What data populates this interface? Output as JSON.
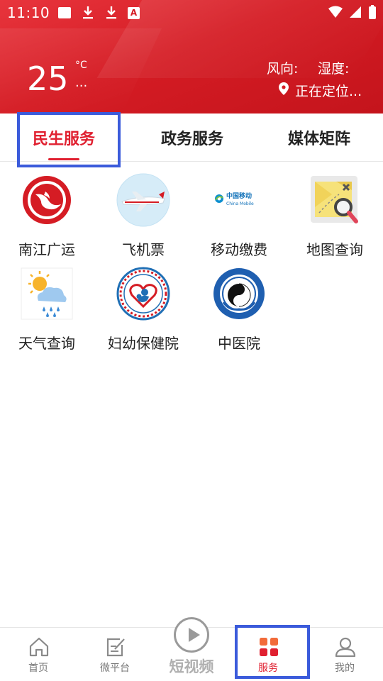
{
  "status_bar": {
    "time": "11:10",
    "icons": [
      "gallery-icon",
      "download-icon",
      "download-icon",
      "app-a-icon",
      "wifi-icon",
      "signal-icon",
      "battery-icon"
    ],
    "app_icon_letter": "A"
  },
  "weather": {
    "temperature": "25",
    "unit": "°C",
    "description": "...",
    "wind_label": "风向:",
    "humidity_label": "湿度:",
    "location_text": "正在定位..."
  },
  "tabs": [
    {
      "label": "民生服务",
      "active": true
    },
    {
      "label": "政务服务",
      "active": false
    },
    {
      "label": "媒体矩阵",
      "active": false
    }
  ],
  "services": [
    {
      "label": "南江广运",
      "icon": "nanjiang-transport-icon"
    },
    {
      "label": "飞机票",
      "icon": "airplane-icon"
    },
    {
      "label": "移动缴费",
      "icon": "china-mobile-icon",
      "logo_text": "中国移动",
      "logo_subtext": "China Mobile"
    },
    {
      "label": "地图查询",
      "icon": "map-search-icon"
    },
    {
      "label": "天气查询",
      "icon": "weather-icon"
    },
    {
      "label": "妇幼保健院",
      "icon": "maternal-hospital-icon"
    },
    {
      "label": "中医院",
      "icon": "tcm-hospital-icon"
    }
  ],
  "bottom_nav": [
    {
      "label": "首页",
      "icon": "home-icon",
      "active": false
    },
    {
      "label": "微平台",
      "icon": "edit-note-icon",
      "active": false
    },
    {
      "label": "短视频",
      "icon": "play-icon",
      "active": false
    },
    {
      "label": "服务",
      "icon": "grid-icon",
      "active": true
    },
    {
      "label": "我的",
      "icon": "user-icon",
      "active": false
    }
  ],
  "colors": {
    "brand_red": "#d51c24",
    "active_tab": "#e02030",
    "highlight": "#3b5bdb",
    "inactive_nav": "#777777"
  }
}
